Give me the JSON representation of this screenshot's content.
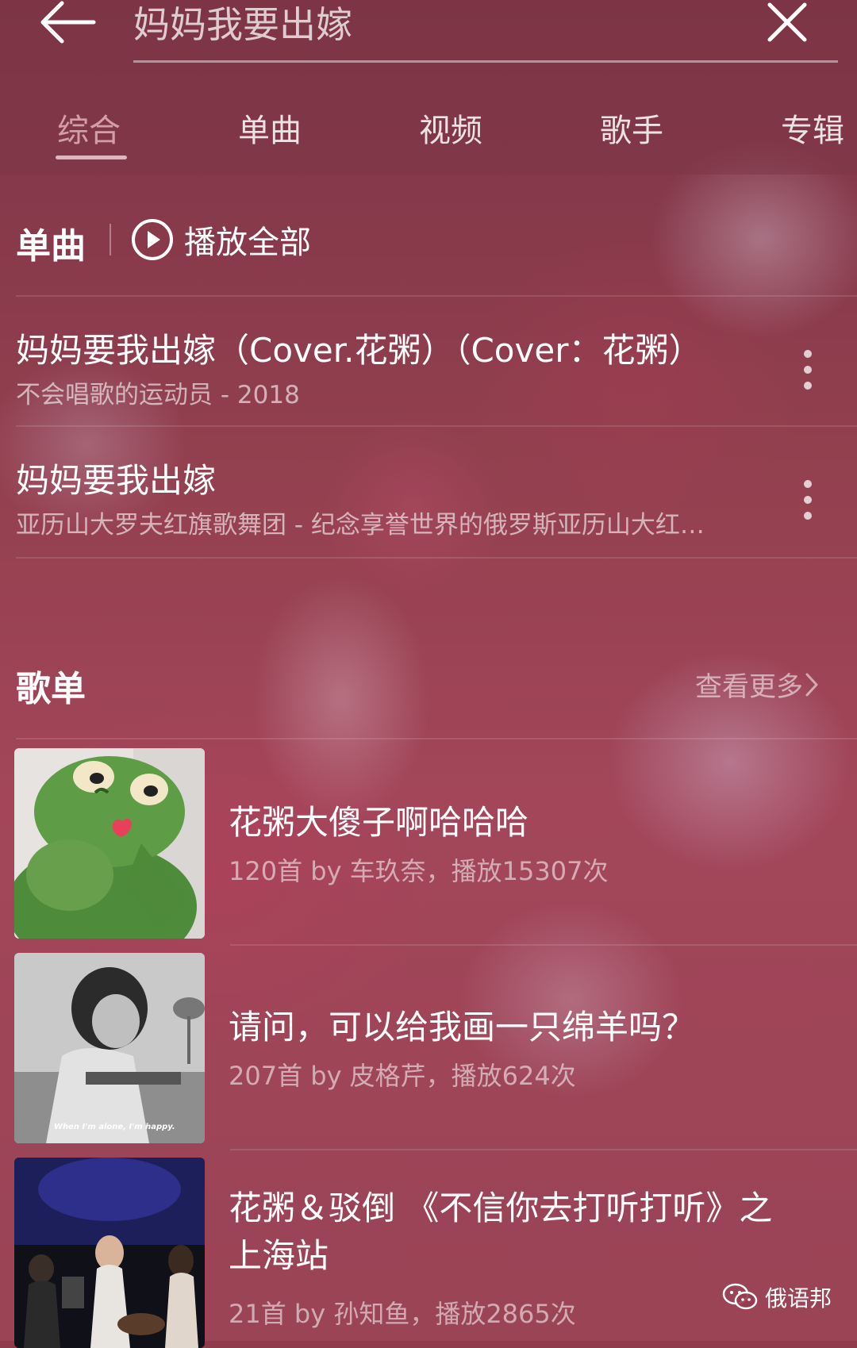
{
  "search": {
    "query": "妈妈我要出嫁"
  },
  "tabs": [
    {
      "label": "综合",
      "active": true
    },
    {
      "label": "单曲",
      "active": false
    },
    {
      "label": "视频",
      "active": false
    },
    {
      "label": "歌手",
      "active": false
    },
    {
      "label": "专辑",
      "active": false
    }
  ],
  "songs_section": {
    "title": "单曲",
    "play_all_label": "播放全部",
    "songs": [
      {
        "title": "妈妈要我出嫁（Cover.花粥）（Cover：花粥）",
        "subtitle": "不会唱歌的运动员 - 2018"
      },
      {
        "title": "妈妈要我出嫁",
        "subtitle": "亚历山大罗夫红旗歌舞团 - 纪念享誉世界的俄罗斯亚历山大红…"
      }
    ]
  },
  "playlists_section": {
    "title": "歌单",
    "see_more_label": "查看更多",
    "playlists": [
      {
        "title": "花粥大傻子啊哈哈哈",
        "subtitle": "120首  by 车玖奈，播放15307次",
        "cover": "kermit-frog-cover"
      },
      {
        "title": "请问，可以给我画一只绵羊吗？",
        "subtitle": "207首  by 皮格芹，播放624次",
        "cover": "girl-at-desk-cover",
        "cover_caption": "When I'm alone, I'm happy."
      },
      {
        "title_line1": "花粥＆驳倒 《不信你去打听打听》之",
        "title_line2": "上海站",
        "subtitle": "21首  by 孙知鱼，播放2865次",
        "cover": "concert-stage-cover"
      }
    ]
  },
  "watermark": {
    "label": "俄语邦",
    "icon": "wechat-icon"
  },
  "colors": {
    "background": "#9a4456",
    "text": "#ffffff",
    "tab_active": "#ffd7dc"
  }
}
